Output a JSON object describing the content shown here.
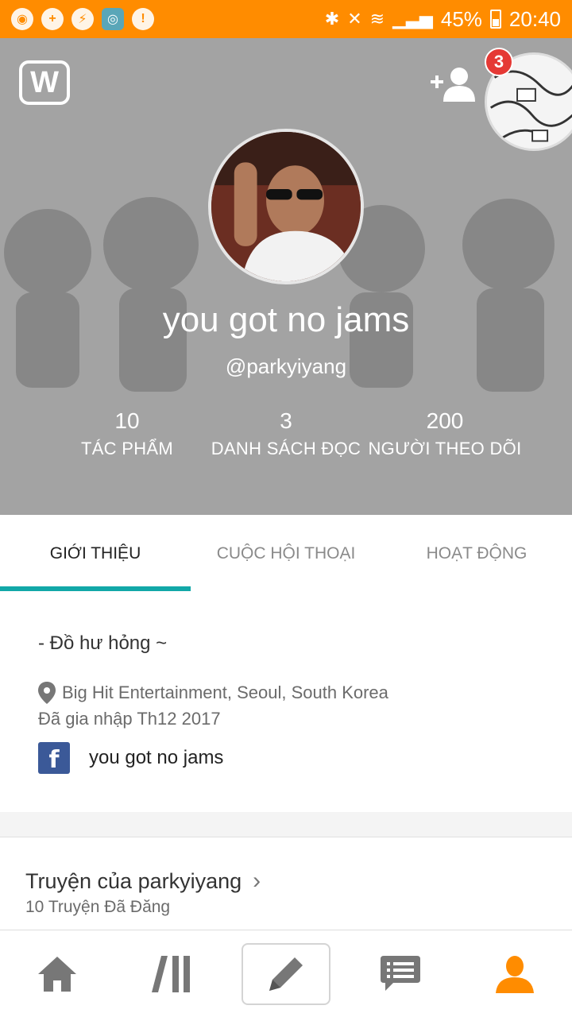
{
  "status_bar": {
    "battery_percent": "45%",
    "time": "20:40",
    "icons": [
      "notification-icon",
      "add-user-icon",
      "messenger-icon",
      "app-icon",
      "alert-icon",
      "bluetooth-icon",
      "mute-icon",
      "wifi-icon",
      "signal-icon",
      "battery-icon"
    ]
  },
  "header": {
    "notification_count": "3",
    "display_name": "you got no jams",
    "username": "@parkyiyang",
    "stats": [
      {
        "value": "10",
        "label": "TÁC PHẨM"
      },
      {
        "value": "3",
        "label": "DANH SÁCH ĐỌC"
      },
      {
        "value": "200",
        "label": "NGƯỜI THEO DÕI"
      }
    ]
  },
  "tabs": [
    {
      "label": "GIỚI THIỆU",
      "active": true
    },
    {
      "label": "CUỘC HỘI THOẠI",
      "active": false
    },
    {
      "label": "HOẠT ĐỘNG",
      "active": false
    }
  ],
  "about": {
    "description": "- Đồ hư hỏng ~",
    "location": "Big Hit Entertainment, Seoul, South Korea",
    "joined": "Đã gia nhập Th12 2017",
    "facebook_name": "you got no jams"
  },
  "stories": {
    "title": "Truyện của parkyiyang",
    "count": "10 Truyện Đã Đăng"
  },
  "bottom_nav": {
    "items": [
      "home-icon",
      "library-icon",
      "write-icon",
      "messages-icon",
      "profile-icon"
    ],
    "active": "profile-icon"
  },
  "colors": {
    "status_bar": "#ff8c00",
    "tab_indicator": "#12a8a8",
    "active_nav": "#ff8c00",
    "facebook": "#3b5998"
  }
}
